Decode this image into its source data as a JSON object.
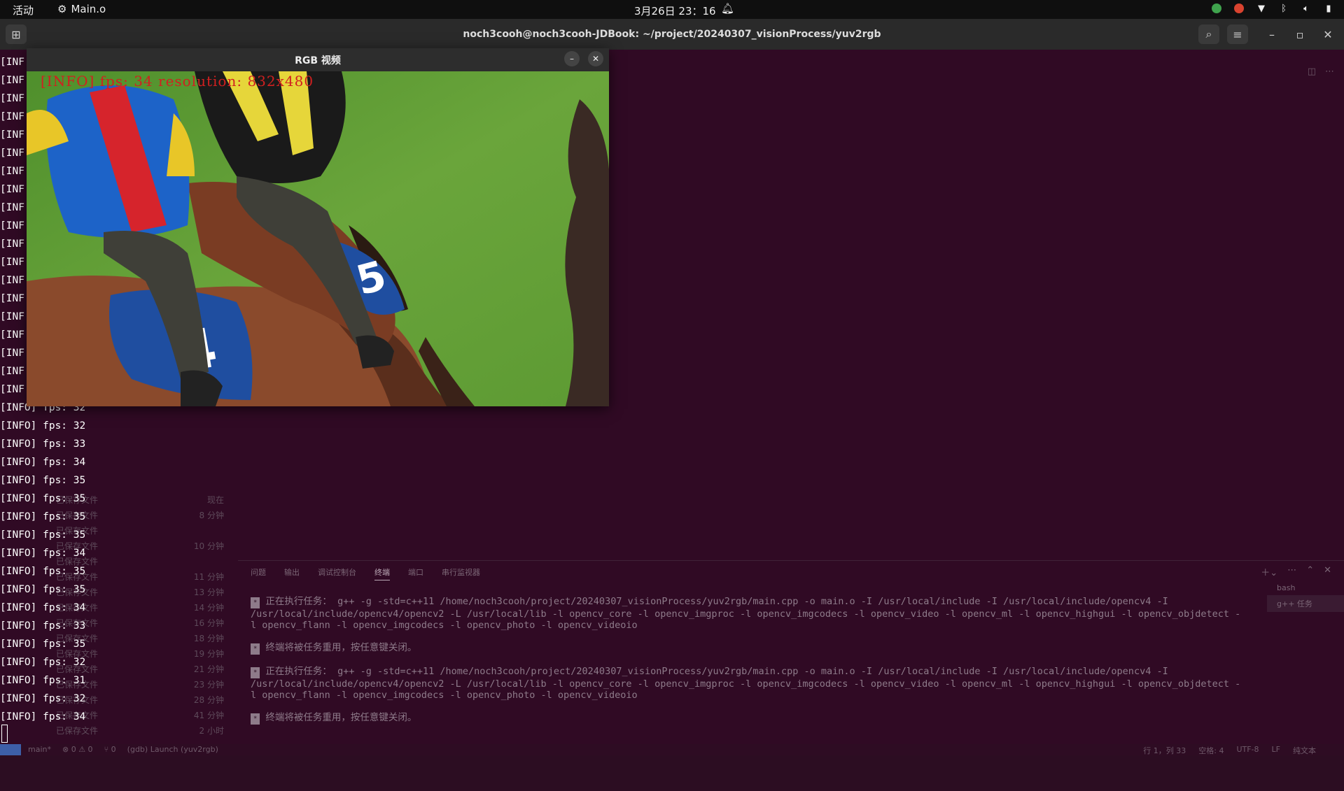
{
  "topbar": {
    "activities": "活动",
    "app_name": "Main.o",
    "clock": "3月26日  23：16"
  },
  "terminal_window": {
    "title": "noch3cooh@noch3cooh-JDBook: ~/project/20240307_visionProcess/yuv2rgb"
  },
  "video_window": {
    "title": "RGB 视频",
    "overlay": "[INFO] fps: 34  resolution: 832x480"
  },
  "log_lines": [
    "[INF",
    "[INF",
    "[INF",
    "[INF",
    "[INF",
    "[INF",
    "[INF",
    "[INF",
    "[INF",
    "[INF",
    "[INF",
    "[INF",
    "[INF",
    "[INF",
    "[INF",
    "[INF",
    "[INF",
    "[INF",
    "[INF",
    "[INFO] fps: 32",
    "[INFO] fps: 32",
    "[INFO] fps: 33",
    "[INFO] fps: 34",
    "[INFO] fps: 35",
    "[INFO] fps: 35",
    "[INFO] fps: 35",
    "[INFO] fps: 35",
    "[INFO] fps: 34",
    "[INFO] fps: 35",
    "[INFO] fps: 35",
    "[INFO] fps: 34",
    "[INFO] fps: 33",
    "[INFO] fps: 35",
    "[INFO] fps: 32",
    "[INFO] fps: 31",
    "[INFO] fps: 32",
    "[INFO] fps: 34"
  ],
  "timeline": [
    {
      "label": "已保存文件",
      "time": "现在"
    },
    {
      "label": "已保存文件",
      "time": "8 分钟"
    },
    {
      "label": "已保存文件",
      "time": ""
    },
    {
      "label": "已保存文件",
      "time": "10 分钟"
    },
    {
      "label": "已保存文件",
      "time": ""
    },
    {
      "label": "已保存文件",
      "time": "11 分钟"
    },
    {
      "label": "已保存文件",
      "time": "13 分钟"
    },
    {
      "label": "已保存文件",
      "time": "14 分钟"
    },
    {
      "label": "已保存文件",
      "time": "16 分钟"
    },
    {
      "label": "已保存文件",
      "time": "18 分钟"
    },
    {
      "label": "已保存文件",
      "time": "19 分钟"
    },
    {
      "label": "已保存文件",
      "time": "21 分钟"
    },
    {
      "label": "已保存文件",
      "time": "23 分钟"
    },
    {
      "label": "已保存文件",
      "time": "28 分钟"
    },
    {
      "label": "已保存文件",
      "time": "41 分钟"
    },
    {
      "label": "已保存文件",
      "time": "2 小时"
    }
  ],
  "panel": {
    "tabs": [
      "问题",
      "输出",
      "调试控制台",
      "终端",
      "端口",
      "串行监视器"
    ],
    "active_tab": "终端",
    "running_label": "正在执行任务：",
    "command": "g++ -g -std=c++11 /home/noch3cooh/project/20240307_visionProcess/yuv2rgb/main.cpp -o main.o -I /usr/local/include -I /usr/local/include/opencv4 -I /usr/local/include/opencv4/opencv2 -L /usr/local/lib -l opencv_core -l opencv_imgproc -l opencv_imgcodecs -l opencv_video -l opencv_ml -l opencv_highgui -l opencv_objdetect -l opencv_flann -l opencv_imgcodecs -l opencv_photo -l opencv_videoio",
    "reuse_msg": "终端将被任务重用，按任意键关闭。",
    "terminals": [
      "bash",
      "g++ 任务"
    ]
  },
  "statusbar": {
    "branch": "main*",
    "problems": "⊗ 0 ⚠ 0",
    "ports": "⑂ 0",
    "launch": "(gdb) Launch (yuv2rgb)",
    "position": "行 1，列 33",
    "spaces": "空格: 4",
    "encoding": "UTF-8",
    "eol": "LF",
    "language": "纯文本"
  }
}
